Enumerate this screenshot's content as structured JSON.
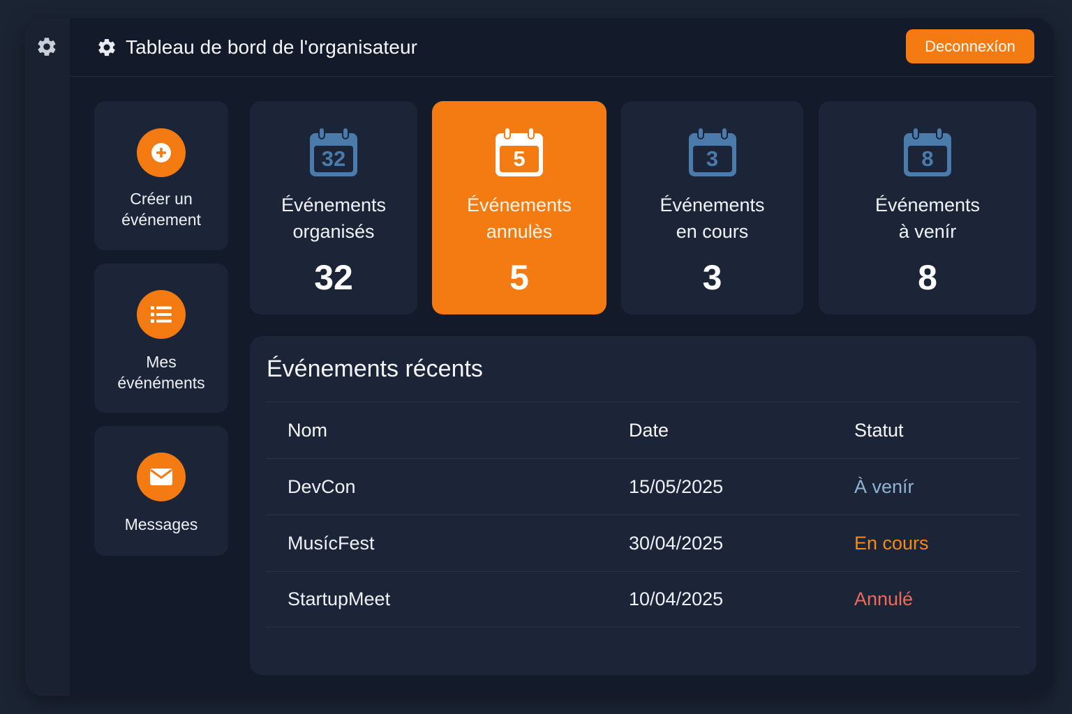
{
  "header": {
    "title": "Tableau de bord de l'organisateur",
    "logout_label": "Deconnexíon"
  },
  "sidebar": {
    "items": [
      {
        "label": "Créer un événement",
        "icon": "plus-circle-icon"
      },
      {
        "label": "Mes événéments",
        "icon": "list-icon"
      },
      {
        "label": "Messages",
        "icon": "envelope-icon"
      }
    ]
  },
  "stats": [
    {
      "icon_number": "32",
      "label_line1": "Événements",
      "label_line2": "organisés",
      "value": "32",
      "active": false
    },
    {
      "icon_number": "5",
      "label_line1": "Événements",
      "label_line2": "annulès",
      "value": "5",
      "active": true
    },
    {
      "icon_number": "3",
      "label_line1": "Événements",
      "label_line2": "en cours",
      "value": "3",
      "active": false
    },
    {
      "icon_number": "8",
      "label_line1": "Événements",
      "label_line2": "à venír",
      "value": "8",
      "active": false
    }
  ],
  "recent": {
    "title": "Événements récents",
    "columns": [
      "Nom",
      "Date",
      "Statut"
    ],
    "rows": [
      {
        "name": "DevCon",
        "date": "15/05/2025",
        "status": "À venír",
        "status_color": "#8fb3d4"
      },
      {
        "name": "MusícFest",
        "date": "30/04/2025",
        "status": "En cours",
        "status_color": "#f28a1c"
      },
      {
        "name": "StartupMeet",
        "date": "10/04/2025",
        "status": "Annulé",
        "status_color": "#ef6a5a"
      }
    ]
  },
  "colors": {
    "accent": "#f47a12",
    "calendar_icon": "#4a7bab"
  }
}
